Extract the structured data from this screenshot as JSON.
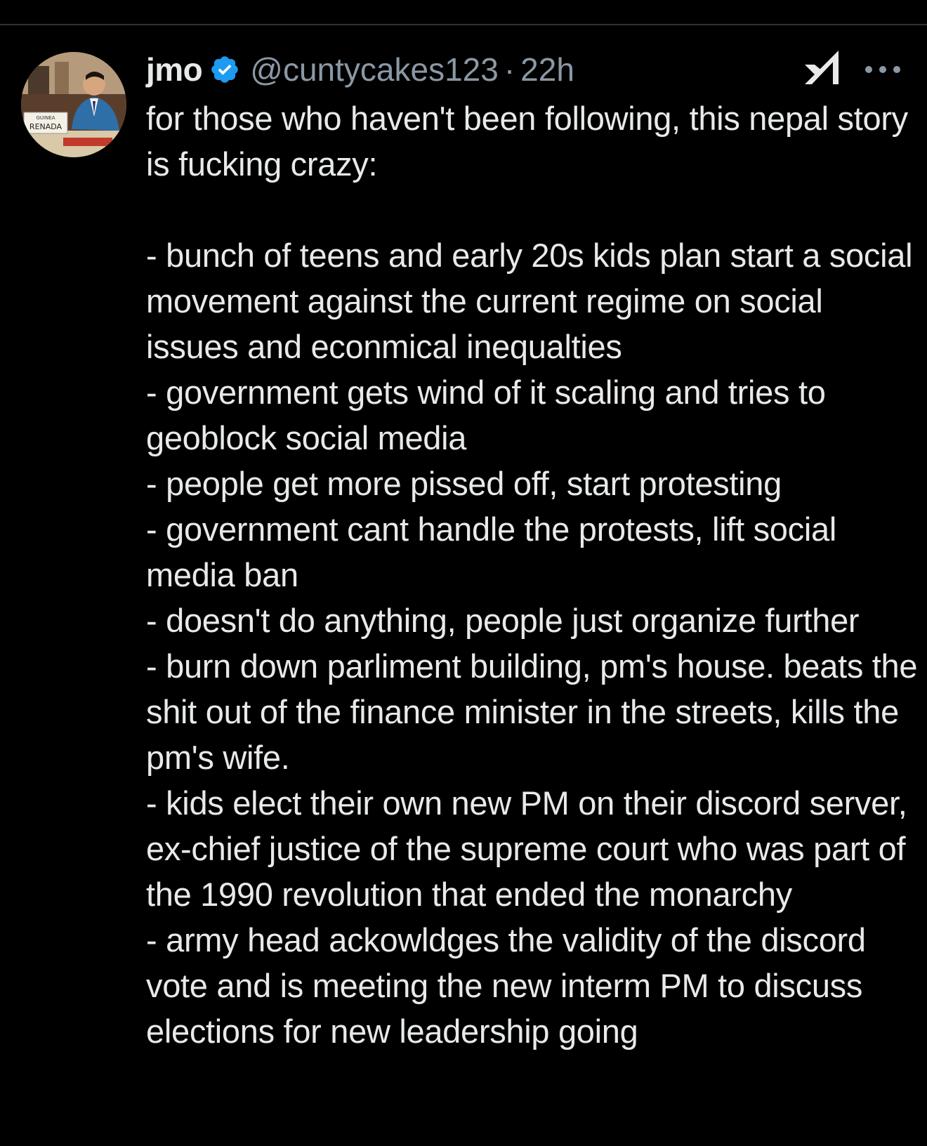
{
  "post": {
    "author": {
      "display_name": "jmo",
      "verified": true,
      "handle": "@cuntycakes123",
      "separator": "·",
      "time": "22h",
      "avatar_text": "RENADA"
    },
    "actions": {
      "grok_icon": "grok-icon",
      "more_icon": "more-icon"
    },
    "text": "for those who haven't been following, this nepal story is fucking crazy:\n\n- bunch of teens and early 20s kids plan start a social movement against the current regime on social issues and econmical inequalties\n- government gets wind of it scaling and tries to geoblock social media\n- people get more pissed off, start protesting\n- government cant handle the protests, lift social media ban\n- doesn't do anything, people just organize further\n- burn down parliment building, pm's house. beats the shit out of the finance minister in the streets, kills the pm's wife.\n- kids elect their own new PM on their discord server, ex-chief justice of the supreme court who was part of the 1990 revolution that ended the monarchy\n- army head ackowldges the validity of the discord vote and is meeting the new interm PM to discuss elections for new leadership going"
  },
  "colors": {
    "background": "#000000",
    "text_primary": "#e7e9ea",
    "text_secondary": "#8b98a5",
    "verified_blue": "#1d9bf0",
    "divider": "#2f3336"
  }
}
